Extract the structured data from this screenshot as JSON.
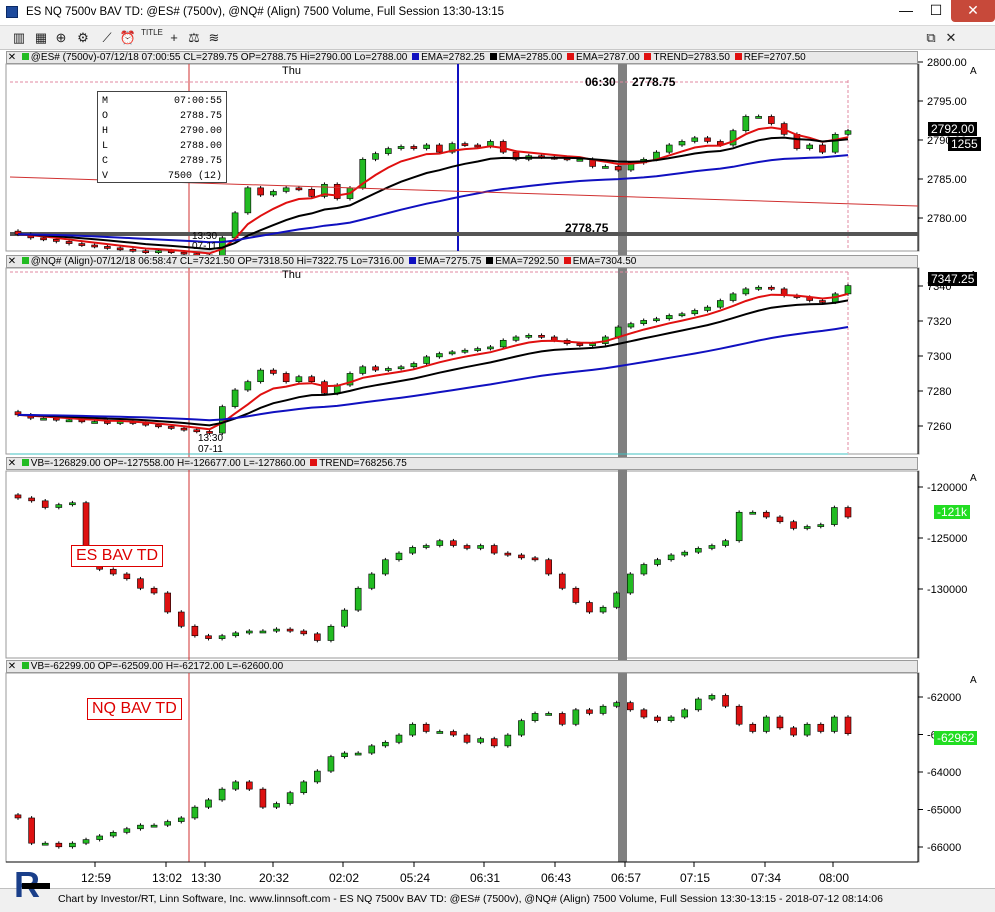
{
  "window": {
    "title": "ES NQ 7500v BAV TD: @ES# (7500v), @NQ# (Align) 7500 Volume, Full Session 13:30-13:15",
    "minimize": "—",
    "maximize": "☐",
    "close": "✕"
  },
  "toolbar": {
    "title_btn": "TITLE",
    "page_restore": "⧉",
    "page_close": "✕"
  },
  "panel1": {
    "head": {
      "symbol": "@ES# (7500v)-07/12/18 07:00:55 CL=2789.75 OP=2788.75 Hi=2790.00 Lo=2788.00",
      "ema1": "EMA=2782.25",
      "ema2": "EMA=2785.00",
      "ema3": "EMA=2787.00",
      "trend": "TREND=2783.50",
      "ref": "REF=2707.50",
      "colors": {
        "ema1": "#1010c0",
        "ema2": "#000000",
        "ema3": "#e01010",
        "trend": "#e01010",
        "ref": "#e01010"
      }
    },
    "day_label": "Thu",
    "top_annotation_time": "06:30",
    "top_annotation_price": "2778.75",
    "hline_label": "2778.75",
    "cursor_time_1": "13:30",
    "cursor_time_2": "07-11",
    "ohlc_box": [
      {
        "k": "M",
        "v": "07:00:55"
      },
      {
        "k": "O",
        "v": "2788.75"
      },
      {
        "k": "H",
        "v": "2790.00"
      },
      {
        "k": "L",
        "v": "2788.00"
      },
      {
        "k": "C",
        "v": "2789.75"
      },
      {
        "k": "V",
        "v": "7500 (12)"
      }
    ],
    "axis_ticks": [
      "2800.00",
      "2795.00",
      "2790.00",
      "2785.00",
      "2780.00"
    ],
    "last_price": "2792.00",
    "last_volume": "1255"
  },
  "panel2": {
    "head": {
      "symbol": "@NQ# (Align)-07/12/18 06:58:47 CL=7321.50 OP=7318.50 Hi=7322.75 Lo=7316.00",
      "ema1": "EMA=7275.75",
      "ema2": "EMA=7292.50",
      "ema3": "EMA=7304.50"
    },
    "day_label": "Thu",
    "cursor_time_1": "13:30",
    "cursor_time_2": "07-11",
    "axis_ticks": [
      "7340",
      "7320",
      "7300",
      "7280",
      "7260"
    ],
    "last_price": "7347.25"
  },
  "panel3": {
    "head": {
      "vb": "VB=-126829.00 OP=-127558.00 H=-126677.00 L=-127860.00",
      "trend": "TREND=768256.75"
    },
    "label": "ES BAV TD",
    "axis_ticks": [
      "-120000",
      "-125000",
      "-130000"
    ],
    "last_value": "-121k"
  },
  "panel4": {
    "head": {
      "vb": "VB=-62299.00 OP=-62509.00 H=-62172.00 L=-62600.00"
    },
    "label": "NQ BAV TD",
    "axis_ticks": [
      "-62000",
      "-63000",
      "-64000",
      "-65000",
      "-66000"
    ],
    "last_value": "-62962"
  },
  "time_axis": [
    "12:59",
    "13:02",
    "13:30",
    "20:32",
    "02:02",
    "05:24",
    "06:31",
    "06:43",
    "06:57",
    "07:15",
    "07:34",
    "08:00"
  ],
  "status": "Chart by Investor/RT, Linn Software, Inc. www.linnsoft.com - ES NQ 7500v BAV TD: @ES# (7500v), @NQ# (Align) 7500 Volume, Full Session 13:30-13:15 - 2018-07-12 08:14:06",
  "colors": {
    "up": "#22bb22",
    "down": "#dd1111",
    "ema_black": "#000000",
    "ema_red": "#e01010",
    "ema_blue": "#1010c0",
    "cursor": "#d03030",
    "highlight": "#808080"
  },
  "chart_data": [
    {
      "type": "candlestick",
      "title": "@ES# (7500v)",
      "ylim": [
        2776.0,
        2800.5
      ],
      "bar_count": 62,
      "closes": [
        2777.5,
        2777.0,
        2776.8,
        2776.5,
        2776.2,
        2776.0,
        2775.8,
        2775.6,
        2775.4,
        2775.2,
        2775.0,
        2775.2,
        2775.0,
        2774.8,
        2774.6,
        2774.4,
        2777.0,
        2780.5,
        2784.0,
        2783.0,
        2783.5,
        2784.0,
        2783.8,
        2782.8,
        2784.5,
        2782.5,
        2784.0,
        2788.0,
        2788.8,
        2789.5,
        2789.8,
        2789.5,
        2790.0,
        2789.0,
        2790.2,
        2790.0,
        2789.8,
        2790.5,
        2789.0,
        2788.0,
        2788.5,
        2788.3,
        2788.2,
        2788.0,
        2788.0,
        2787.0,
        2787.0,
        2786.5,
        2787.5,
        2788.0,
        2789.0,
        2790.0,
        2790.5,
        2791.0,
        2790.5,
        2790.0,
        2792.0,
        2794.0,
        2794.0,
        2793.0,
        2791.5,
        2789.5,
        2790.0,
        2789.0,
        2791.5,
        2792.0
      ]
    },
    {
      "type": "candlestick",
      "title": "@NQ# (Align)",
      "ylim": [
        7245,
        7350
      ],
      "bar_count": 62,
      "closes": [
        7265,
        7263,
        7263,
        7262,
        7262,
        7261,
        7261,
        7260,
        7261,
        7260,
        7259,
        7258,
        7257,
        7256,
        7255,
        7254,
        7270,
        7280,
        7285,
        7292,
        7290,
        7285,
        7288,
        7285,
        7278,
        7283,
        7290,
        7294,
        7292,
        7293,
        7294,
        7296,
        7300,
        7302,
        7303,
        7304,
        7305,
        7306,
        7310,
        7312,
        7313,
        7312,
        7310,
        7308,
        7307,
        7308,
        7312,
        7318,
        7320,
        7322,
        7323,
        7325,
        7326,
        7328,
        7330,
        7334,
        7338,
        7341,
        7342,
        7341,
        7337,
        7336,
        7334,
        7333,
        7338,
        7343
      ]
    },
    {
      "type": "candlestick",
      "title": "VB",
      "ylim": [
        -136000,
        -118000
      ],
      "bar_count": 62,
      "closes": [
        -120000,
        -120300,
        -121000,
        -120700,
        -120500,
        -126500,
        -127500,
        -128000,
        -128500,
        -129500,
        -130000,
        -132000,
        -133500,
        -134500,
        -134800,
        -134500,
        -134200,
        -134000,
        -134000,
        -133800,
        -134000,
        -134300,
        -135000,
        -133500,
        -131800,
        -129500,
        -128000,
        -126500,
        -125800,
        -125200,
        -125000,
        -124500,
        -125000,
        -125300,
        -125000,
        -125800,
        -126000,
        -126300,
        -126500,
        -128000,
        -129500,
        -131000,
        -132000,
        -131500,
        -130000,
        -128000,
        -127000,
        -126500,
        -126000,
        -125700,
        -125300,
        -125000,
        -124500,
        -121500,
        -121500,
        -122000,
        -122500,
        -123200,
        -123000,
        -122800,
        -121000,
        -122000
      ]
    },
    {
      "type": "candlestick",
      "title": "VB",
      "ylim": [
        -66300,
        -61500
      ],
      "bar_count": 62,
      "closes": [
        -65300,
        -66000,
        -66000,
        -66100,
        -66000,
        -65900,
        -65800,
        -65700,
        -65600,
        -65500,
        -65500,
        -65400,
        -65300,
        -65000,
        -64800,
        -64500,
        -64300,
        -64500,
        -65000,
        -64900,
        -64600,
        -64300,
        -64000,
        -63600,
        -63500,
        -63500,
        -63300,
        -63200,
        -63000,
        -62700,
        -62900,
        -62900,
        -63000,
        -63200,
        -63100,
        -63300,
        -63000,
        -62600,
        -62400,
        -62400,
        -62700,
        -62300,
        -62400,
        -62200,
        -62100,
        -62300,
        -62500,
        -62600,
        -62500,
        -62300,
        -62000,
        -61900,
        -62200,
        -62700,
        -62900,
        -62500,
        -62800,
        -63000,
        -62700,
        -62900,
        -62500,
        -62962
      ]
    }
  ]
}
